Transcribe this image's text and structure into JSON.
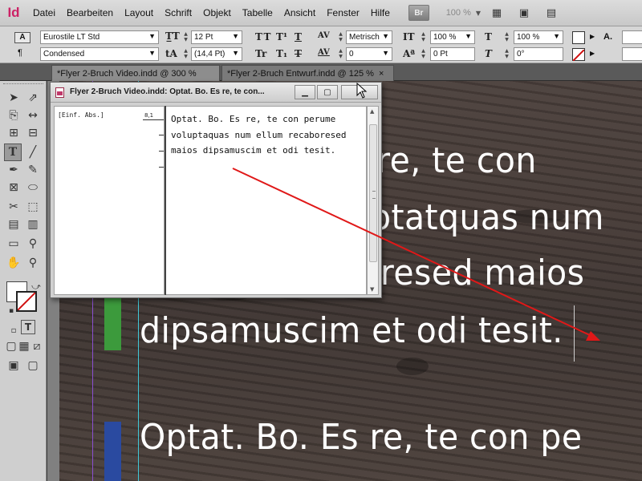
{
  "app": {
    "logo": "Id",
    "menu": [
      "Datei",
      "Bearbeiten",
      "Layout",
      "Schrift",
      "Objekt",
      "Tabelle",
      "Ansicht",
      "Fenster",
      "Hilfe"
    ],
    "bridge_label": "Br",
    "zoom": "100 %"
  },
  "control": {
    "font_family": "Eurostile LT Std",
    "font_style": "Condensed",
    "font_size": "12 Pt",
    "leading": "(14,4 Pt)",
    "kerning": "Metrisch",
    "tracking": "0",
    "vertical_scale": "100 %",
    "horizontal_scale": "100 %",
    "baseline_shift": "0 Pt",
    "skew": "0°",
    "char_style_label": "A."
  },
  "tabs": [
    {
      "label": "*Flyer 2-Bruch Video.indd @ 300 %"
    },
    {
      "label": "*Flyer 2-Bruch Entwurf.indd @ 125 %"
    }
  ],
  "canvas": {
    "lines": [
      "s re, te con",
      "otatquas num",
      "resed maios",
      "dipsamuscim et odi tesit.",
      "Optat. Bo. Es re, te con pe"
    ],
    "colors": {
      "green_bar": "#3c9a3c",
      "blue_bar": "#2a4aa0",
      "arrow": "#e01818"
    }
  },
  "story_editor": {
    "title": "Flyer 2-Bruch Video.indd: Optat. Bo. Es re, te con...",
    "style_name": "[Einf. Abs.]",
    "ruler_value": "8,1",
    "text": "Optat. Bo. Es re, te con perume voluptaquas num ellum recaboresed maios dipsamuscim et odi tesit."
  }
}
